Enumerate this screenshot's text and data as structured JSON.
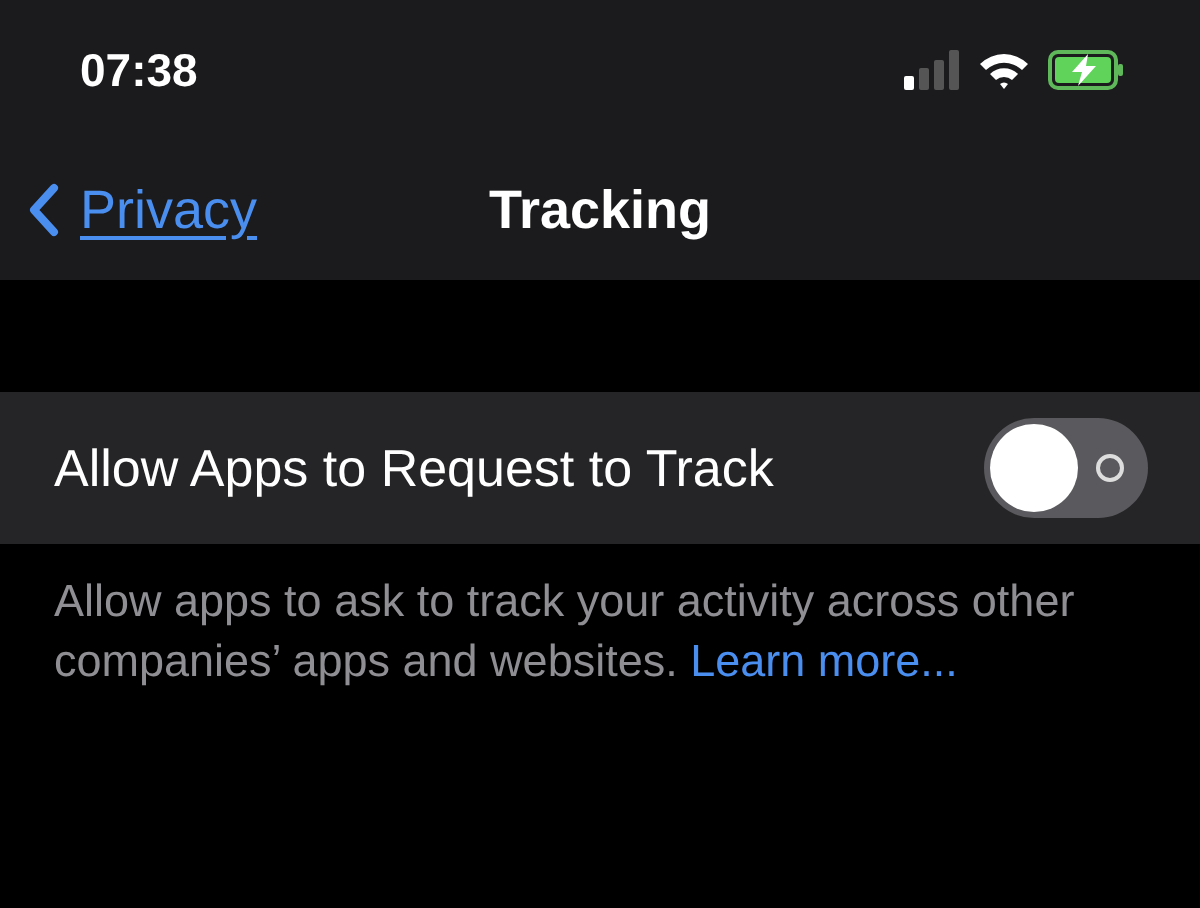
{
  "status_bar": {
    "time": "07:38"
  },
  "nav_bar": {
    "back_label": "Privacy",
    "title": "Tracking"
  },
  "settings": [
    {
      "kind": "toggle",
      "label": "Allow Apps to Request to Track",
      "on": false
    }
  ],
  "footer": {
    "text": "Allow apps to ask to track your activity across other companies’ apps and websites.",
    "link": "Learn more..."
  }
}
